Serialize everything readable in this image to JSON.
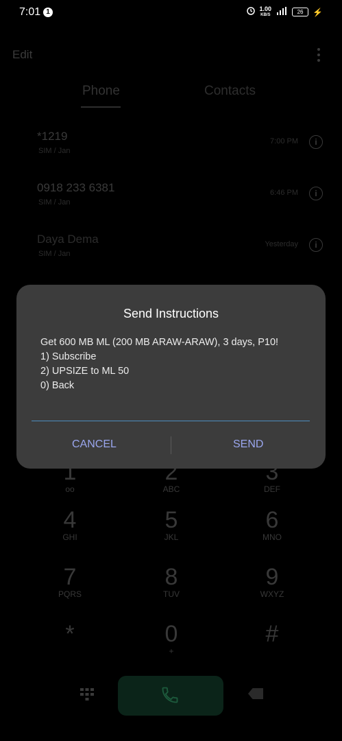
{
  "status_bar": {
    "time": "7:01",
    "notification_count": "1",
    "net_speed": "1.00",
    "net_speed_unit": "KB/S",
    "battery": "26"
  },
  "header": {
    "edit_label": "Edit"
  },
  "tabs": [
    {
      "label": "Phone"
    },
    {
      "label": "Contacts"
    }
  ],
  "call_log": [
    {
      "number": "*1219",
      "sub": "SIM / Jan",
      "time": "7:00 PM"
    },
    {
      "number": "0918 233 6381",
      "sub": "SIM / Jan",
      "time": "6:46 PM"
    },
    {
      "number": "Daya Dema",
      "sub": "SIM / Jan",
      "time": "Yesterday"
    }
  ],
  "keypad": [
    {
      "digit": "1",
      "letters": "oo"
    },
    {
      "digit": "2",
      "letters": "ABC"
    },
    {
      "digit": "3",
      "letters": "DEF"
    },
    {
      "digit": "4",
      "letters": "GHI"
    },
    {
      "digit": "5",
      "letters": "JKL"
    },
    {
      "digit": "6",
      "letters": "MNO"
    },
    {
      "digit": "7",
      "letters": "PQRS"
    },
    {
      "digit": "8",
      "letters": "TUV"
    },
    {
      "digit": "9",
      "letters": "WXYZ"
    },
    {
      "digit": "*",
      "letters": ""
    },
    {
      "digit": "0",
      "letters": "+"
    },
    {
      "digit": "#",
      "letters": ""
    }
  ],
  "dialog": {
    "title": "Send Instructions",
    "lines": [
      "Get 600 MB ML (200 MB ARAW-ARAW), 3 days, P10!",
      "1) Subscribe",
      "2) UPSIZE to ML 50",
      "0) Back"
    ],
    "input_value": "",
    "cancel_label": "CANCEL",
    "send_label": "SEND"
  },
  "colors": {
    "dialog_bg": "#3c3c3c",
    "button_text": "#9aa6ee",
    "input_underline": "#4d8dc0",
    "call_button": "#0b2419"
  },
  "icons": [
    "alarm-icon",
    "signal-icon",
    "battery-icon",
    "kebab-menu-icon",
    "info-icon",
    "dialpad-icon",
    "phone-icon",
    "backspace-icon"
  ]
}
